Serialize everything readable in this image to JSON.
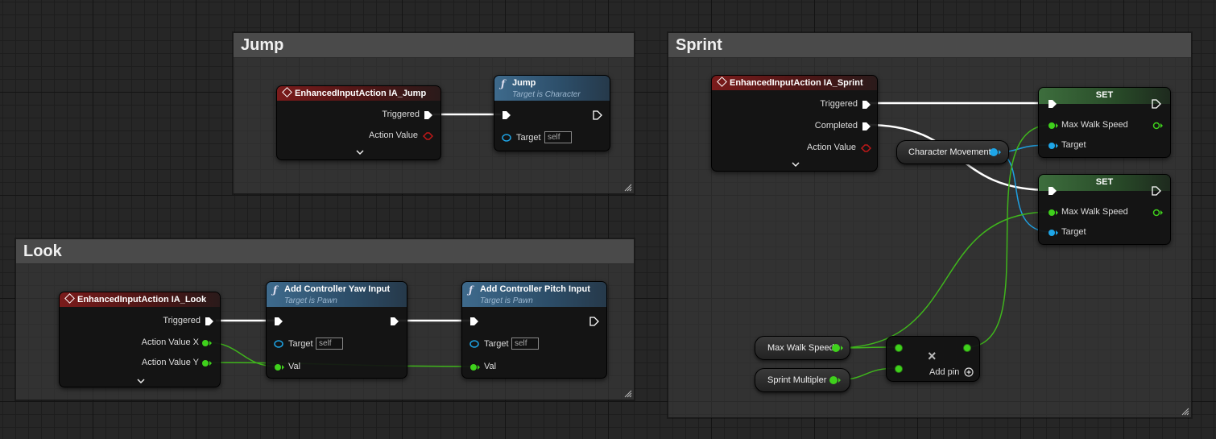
{
  "comments": {
    "jump": "Jump",
    "look": "Look",
    "sprint": "Sprint"
  },
  "jump": {
    "event": {
      "title": "EnhancedInputAction IA_Jump",
      "triggered": "Triggered",
      "action_value": "Action Value"
    },
    "func": {
      "title": "Jump",
      "subtitle": "Target is Character",
      "target": "Target",
      "self": "self"
    }
  },
  "look": {
    "event": {
      "title": "EnhancedInputAction IA_Look",
      "triggered": "Triggered",
      "x": "Action Value X",
      "y": "Action Value Y"
    },
    "yaw": {
      "title": "Add Controller Yaw Input",
      "subtitle": "Target is Pawn",
      "target": "Target",
      "self": "self",
      "val": "Val"
    },
    "pitch": {
      "title": "Add Controller Pitch Input",
      "subtitle": "Target is Pawn",
      "target": "Target",
      "self": "self",
      "val": "Val"
    }
  },
  "sprint": {
    "event": {
      "title": "EnhancedInputAction IA_Sprint",
      "triggered": "Triggered",
      "completed": "Completed",
      "action_value": "Action Value"
    },
    "char_move": "Character Movement",
    "set": {
      "title": "SET",
      "max_walk_speed": "Max Walk Speed",
      "target": "Target"
    },
    "max_walk_var": "Max Walk Speed",
    "sprint_mult": "Sprint Multipler",
    "multiply": {
      "add_pin": "Add pin",
      "symbol": "×"
    }
  },
  "colors": {
    "exec": "#ffffff",
    "float": "#6ed12c",
    "object": "#1ea6e8",
    "event_head": "#7a1b1b",
    "func_head": "#3e6a8c",
    "set_head": "#3d6e3d"
  }
}
